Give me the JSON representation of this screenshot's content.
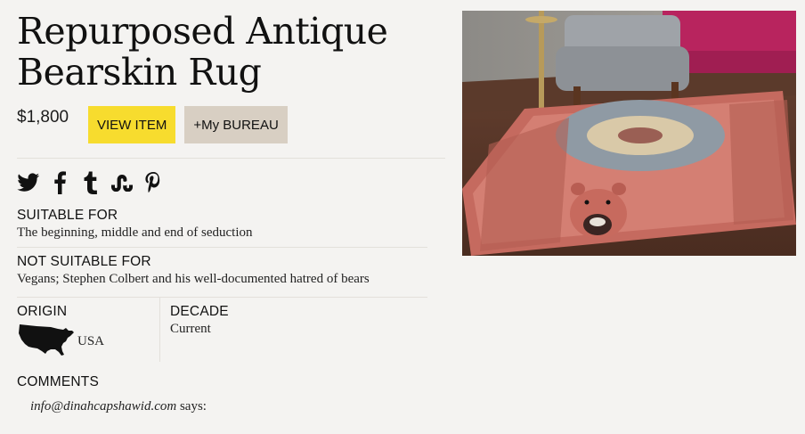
{
  "product": {
    "title_line1": "Repurposed Antique",
    "title_line2": "Bearskin Rug",
    "price": "$1,800"
  },
  "actions": {
    "view_item": "VIEW ITEM",
    "my_bureau": "+My BUREAU"
  },
  "social": [
    "twitter-icon",
    "facebook-icon",
    "tumblr-icon",
    "stumbleupon-icon",
    "pinterest-icon"
  ],
  "details": {
    "suitable_for_label": "SUITABLE FOR",
    "suitable_for_value": "The beginning, middle and end of seduction",
    "not_suitable_for_label": "NOT SUITABLE FOR",
    "not_suitable_for_value": "Vegans; Stephen Colbert and his well-documented hatred of bears",
    "origin_label": "ORIGIN",
    "origin_value": "USA",
    "decade_label": "DECADE",
    "decade_value": "Current"
  },
  "comments": {
    "label": "COMMENTS",
    "author": "info@dinahcapshawid.com",
    "says": " says:"
  },
  "colors": {
    "background": "#f4f3f1",
    "view_button": "#f7dc2e",
    "bureau_button": "#d8cfc3"
  }
}
